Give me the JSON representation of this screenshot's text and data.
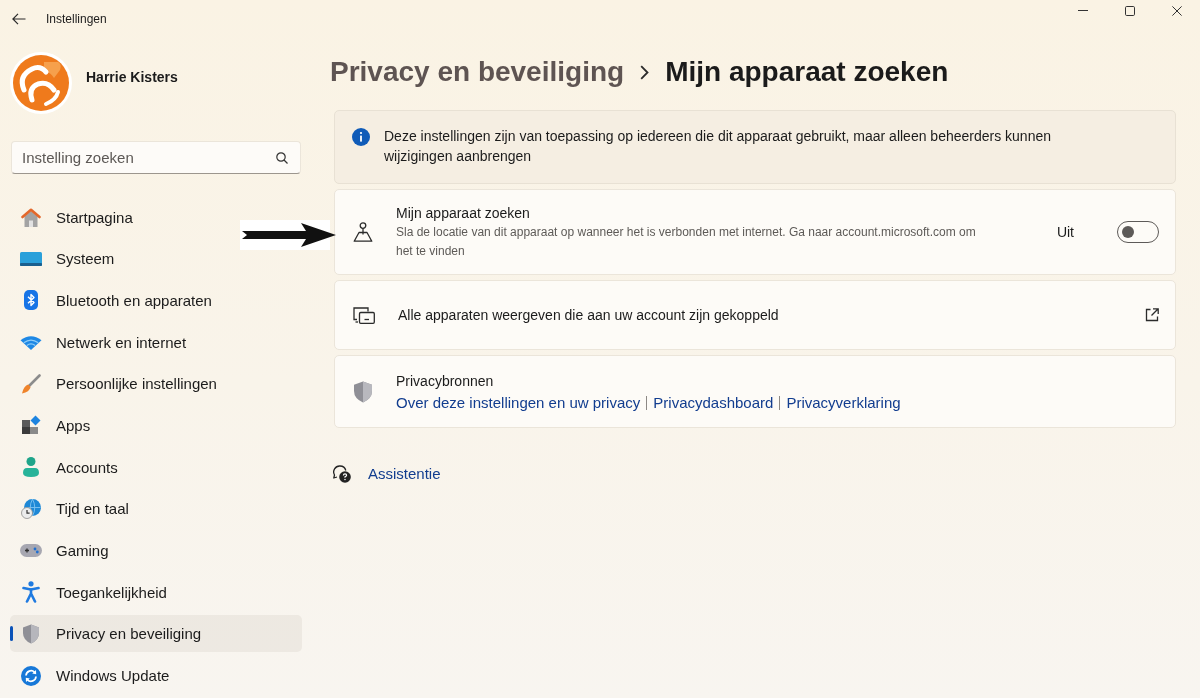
{
  "window": {
    "title": "Instellingen"
  },
  "profile": {
    "name": "Harrie Kisters"
  },
  "search": {
    "placeholder": "Instelling zoeken"
  },
  "sidebar": {
    "items": [
      {
        "label": "Startpagina",
        "selected": false
      },
      {
        "label": "Systeem",
        "selected": false
      },
      {
        "label": "Bluetooth en apparaten",
        "selected": false
      },
      {
        "label": "Netwerk en internet",
        "selected": false
      },
      {
        "label": "Persoonlijke instellingen",
        "selected": false
      },
      {
        "label": "Apps",
        "selected": false
      },
      {
        "label": "Accounts",
        "selected": false
      },
      {
        "label": "Tijd en taal",
        "selected": false
      },
      {
        "label": "Gaming",
        "selected": false
      },
      {
        "label": "Toegankelijkheid",
        "selected": false
      },
      {
        "label": "Privacy en beveiliging",
        "selected": true
      },
      {
        "label": "Windows Update",
        "selected": false
      }
    ]
  },
  "breadcrumb": {
    "parent": "Privacy en beveiliging",
    "current": "Mijn apparaat zoeken"
  },
  "info_banner": {
    "text": "Deze instellingen zijn van toepassing op iedereen die dit apparaat gebruikt, maar alleen beheerders kunnen wijzigingen aanbrengen"
  },
  "settings": [
    {
      "kind": "toggle",
      "title": "Mijn apparaat zoeken",
      "description": "Sla de locatie van dit apparaat op wanneer het is verbonden met internet. Ga naar account.microsoft.com om het te vinden",
      "state_label": "Uit",
      "on": false
    },
    {
      "kind": "link",
      "title": "Alle apparaten weergeven die aan uw account zijn gekoppeld",
      "external": true
    },
    {
      "kind": "resources",
      "title": "Privacybronnen",
      "links": [
        "Over deze instellingen en uw privacy",
        "Privacydashboard",
        "Privacyverklaring"
      ]
    }
  ],
  "help_link": {
    "label": "Assistentie"
  }
}
